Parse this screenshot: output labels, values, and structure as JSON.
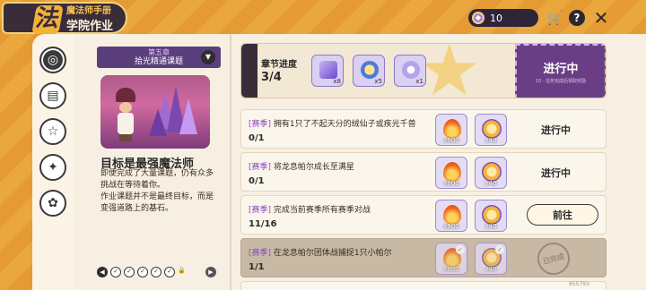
{
  "header": {
    "logo_glyph": "法",
    "subtitle": "魔法师手册",
    "title": "学院作业"
  },
  "topbar": {
    "currency_value": "10",
    "icons": [
      "coin-icon",
      "cart-icon",
      "help-icon",
      "close-icon"
    ]
  },
  "rail": {
    "tabs": [
      {
        "icon": "target-icon",
        "active": true
      },
      {
        "icon": "book-icon",
        "active": false
      },
      {
        "icon": "star-icon",
        "active": false
      },
      {
        "icon": "magic-icon",
        "active": false
      },
      {
        "icon": "badge-icon",
        "active": false
      }
    ]
  },
  "chapter": {
    "number": "第五章",
    "title": "拾光精通课题",
    "goal_title": "目标是最强魔法师",
    "description": "即便完成了大量课题，仍有众多挑战在等待着你。\n作业课题并不是最终目标，而是变强道路上的基石。"
  },
  "banner": {
    "label": "章节进度",
    "value": "3/4",
    "chests": [
      {
        "count": "x8",
        "color": "#8e72d6"
      },
      {
        "count": "x5",
        "color": "#f2c14e"
      },
      {
        "count": "x1",
        "color": "#b7a7e6"
      }
    ],
    "status": "进行中",
    "status_sub": "10 · 任务完成后领取奖励"
  },
  "tasks": [
    {
      "tag": "[赛季]",
      "text": "拥有1只了不起天分的绒仙子或疾光千兽",
      "progress": "0/1",
      "rewards": [
        "x600",
        "x40"
      ],
      "status": "进行中",
      "state": "in_progress"
    },
    {
      "tag": "[赛季]",
      "text": "将龙息帕尔成长至满星",
      "progress": "0/1",
      "rewards": [
        "x600",
        "x40"
      ],
      "status": "进行中",
      "state": "in_progress"
    },
    {
      "tag": "[赛季]",
      "text": "完成当前赛季所有赛季对战",
      "progress": "11/16",
      "rewards": [
        "x600",
        "x40"
      ],
      "status": "前往",
      "state": "go"
    },
    {
      "tag": "[赛季]",
      "text": "在龙息帕尔团体战捕捉1只小帕尔",
      "progress": "1/1",
      "rewards": [
        "x600",
        "x40"
      ],
      "status": "已完成",
      "state": "done"
    }
  ],
  "footer": {
    "uid": "855793"
  }
}
